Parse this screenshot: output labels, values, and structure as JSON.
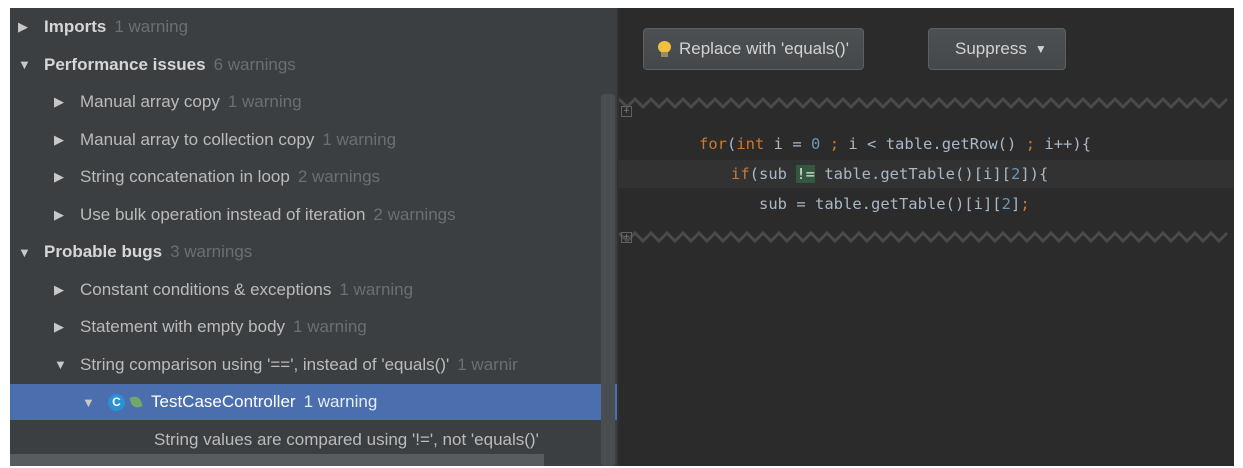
{
  "tree": {
    "rows": [
      {
        "kind": "cat",
        "expanded": false,
        "label": "Imports",
        "count": "1 warning"
      },
      {
        "kind": "cat",
        "expanded": true,
        "label": "Performance issues",
        "count": "6 warnings"
      },
      {
        "kind": "sub",
        "expanded": false,
        "label": "Manual array copy",
        "count": "1 warning"
      },
      {
        "kind": "sub",
        "expanded": false,
        "label": "Manual array to collection copy",
        "count": "1 warning"
      },
      {
        "kind": "sub",
        "expanded": false,
        "label": "String concatenation in loop",
        "count": "2 warnings"
      },
      {
        "kind": "sub",
        "expanded": false,
        "label": "Use bulk operation instead of iteration",
        "count": "2 warnings"
      },
      {
        "kind": "cat",
        "expanded": true,
        "label": "Probable bugs",
        "count": "3 warnings"
      },
      {
        "kind": "sub",
        "expanded": false,
        "label": "Constant conditions & exceptions",
        "count": "1 warning"
      },
      {
        "kind": "sub",
        "expanded": false,
        "label": "Statement with empty body",
        "count": "1 warning"
      },
      {
        "kind": "sub",
        "expanded": true,
        "label": "String comparison using '==', instead of 'equals()'",
        "count": "1 warnir"
      },
      {
        "kind": "class",
        "expanded": true,
        "selected": true,
        "icon": "class-c-icon",
        "label": "TestCaseController",
        "count": "1 warning"
      },
      {
        "kind": "problem",
        "label": "String values are compared using '!=', not 'equals()'",
        "count": ""
      }
    ]
  },
  "preview": {
    "replace_button": "Replace with 'equals()'",
    "suppress_button": "Suppress",
    "gutter_mark": "+",
    "code": {
      "line1": {
        "kw1": "for",
        "p1": "(",
        "kw2": "int",
        "p2": " i = ",
        "n1": "0",
        "p3": " ",
        "s1": ";",
        "p4": " i < table.getRow() ",
        "s2": ";",
        "p5": " i++){"
      },
      "line2": {
        "kw1": "if",
        "p1": "(sub ",
        "op": "!=",
        "p2": " table.getTable()[i][",
        "n1": "2",
        "p3": "]){"
      },
      "line3": {
        "p1": "sub = table.getTable()[i][",
        "n1": "2",
        "p2": "]",
        "s1": ";"
      }
    }
  },
  "colors": {
    "selection": "#4b6eaf",
    "keyword": "#cc7832",
    "number": "#6897bb",
    "panel": "#3c3f41",
    "editor": "#2b2b2b"
  }
}
